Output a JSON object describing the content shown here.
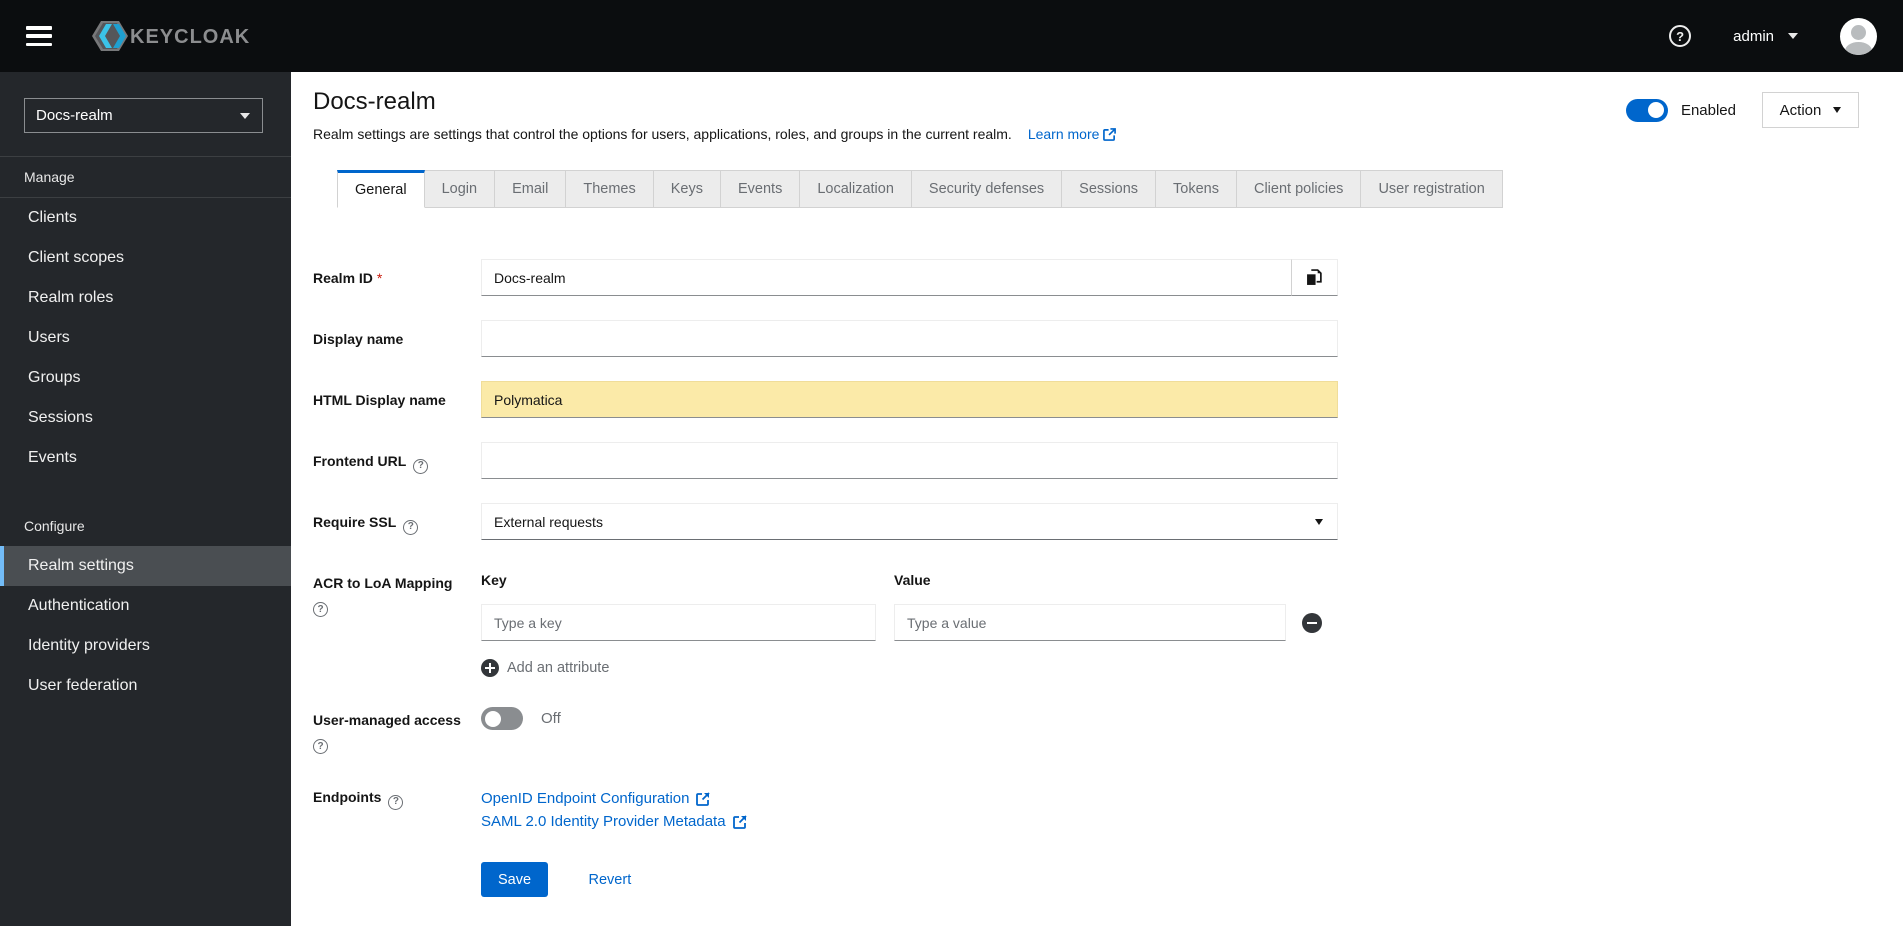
{
  "masthead": {
    "brand": "KEYCLOAK",
    "user": "admin"
  },
  "sidebar": {
    "realm_selector": "Docs-realm",
    "groups": [
      {
        "label": "Manage",
        "items": [
          "Clients",
          "Client scopes",
          "Realm roles",
          "Users",
          "Groups",
          "Sessions",
          "Events"
        ]
      },
      {
        "label": "Configure",
        "items": [
          "Realm settings",
          "Authentication",
          "Identity providers",
          "User federation"
        ],
        "active_item": "Realm settings"
      }
    ]
  },
  "header": {
    "title": "Docs-realm",
    "description": "Realm settings are settings that control the options for users, applications, roles, and groups in the current realm.",
    "learn_more": "Learn more",
    "enabled_label": "Enabled",
    "action_label": "Action"
  },
  "tabs": {
    "active": "General",
    "items": [
      "General",
      "Login",
      "Email",
      "Themes",
      "Keys",
      "Events",
      "Localization",
      "Security defenses",
      "Sessions",
      "Tokens",
      "Client policies",
      "User registration"
    ]
  },
  "form": {
    "realm_id": {
      "label": "Realm ID",
      "required_marker": "*",
      "value": "Docs-realm"
    },
    "display_name": {
      "label": "Display name",
      "value": ""
    },
    "html_display_name": {
      "label": "HTML Display name",
      "value": "Polymatica"
    },
    "frontend_url": {
      "label": "Frontend URL",
      "value": ""
    },
    "require_ssl": {
      "label": "Require SSL",
      "value": "External requests"
    },
    "acr_mapping": {
      "label": "ACR to LoA Mapping",
      "key_header": "Key",
      "value_header": "Value",
      "key_placeholder": "Type a key",
      "value_placeholder": "Type a value",
      "add_label": "Add an attribute"
    },
    "user_managed_access": {
      "label": "User-managed access",
      "state": "Off"
    },
    "endpoints": {
      "label": "Endpoints",
      "links": [
        "OpenID Endpoint Configuration",
        "SAML 2.0 Identity Provider Metadata"
      ]
    },
    "actions": {
      "save": "Save",
      "revert": "Revert"
    }
  },
  "colors": {
    "accent": "#0066cc",
    "masthead_bg": "#0b0d0f",
    "sidebar_bg": "#24272b",
    "active_nav_bg": "#4a4e52",
    "active_nav_border": "#73bcf7",
    "highlight_input_bg": "#fbeaa8",
    "danger": "#c9190b"
  }
}
